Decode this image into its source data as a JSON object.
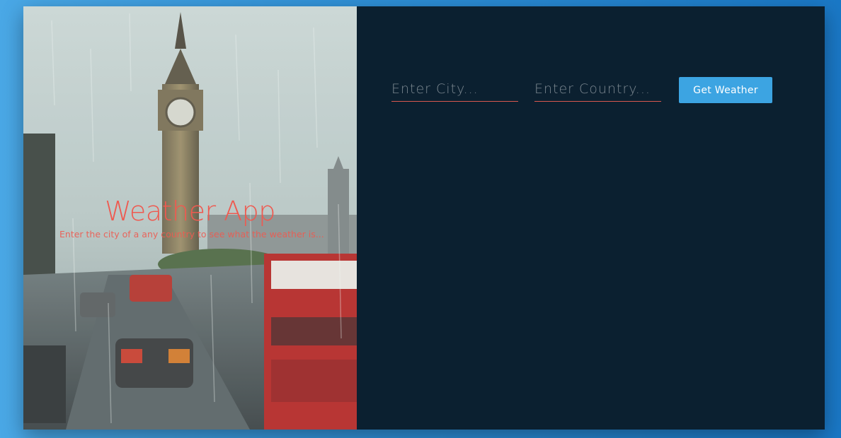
{
  "hero": {
    "title": "Weather App",
    "subtitle": "Enter the city of a any country to see what the weather is..."
  },
  "form": {
    "city_placeholder": "Enter City...",
    "city_value": "",
    "country_placeholder": "Enter Country...",
    "country_value": "",
    "submit_label": "Get Weather"
  },
  "colors": {
    "page_background": "#2e8fd6",
    "panel_background": "#0b2030",
    "accent_text": "#ee5a50",
    "input_underline": "#d9584f",
    "button_background": "#3ca4e2"
  }
}
